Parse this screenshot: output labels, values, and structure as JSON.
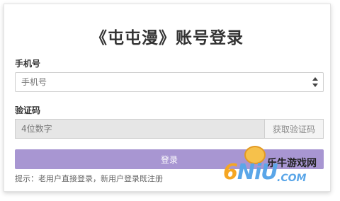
{
  "page": {
    "title": "《屯屯漫》账号登录"
  },
  "phone": {
    "label": "手机号",
    "placeholder": "手机号"
  },
  "code": {
    "label": "验证码",
    "placeholder": "4位数字",
    "send_button": "获取验证码"
  },
  "login_button": "登录",
  "hint": "提示：老用户直接登录，新用户登录既注册",
  "watermark": {
    "site_name": "乐牛游戏网",
    "logo_six": "6",
    "logo_main": "NiU",
    "logo_com": ".COM"
  },
  "colors": {
    "login_button": "#a896d2",
    "code_field_bg": "#e6e6e6",
    "logo_blue": "#5aa6e8",
    "logo_orange": "#f5a623"
  }
}
